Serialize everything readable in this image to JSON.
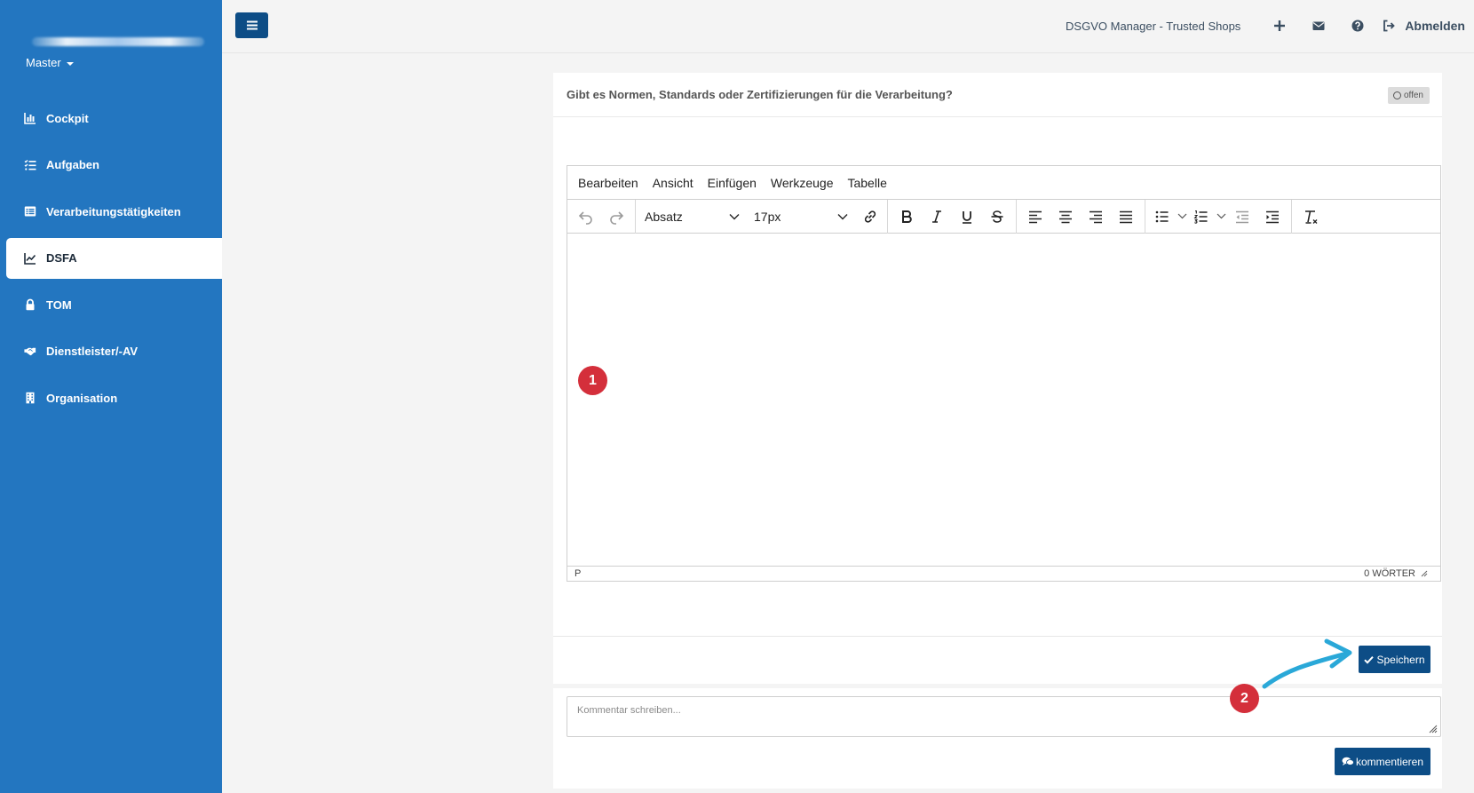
{
  "sidebar": {
    "org_selector": "Master",
    "items": [
      {
        "label": "Cockpit",
        "icon": "bar-chart-icon"
      },
      {
        "label": "Aufgaben",
        "icon": "task-list-icon"
      },
      {
        "label": "Verarbeitungstätigkeiten",
        "icon": "list-alt-icon"
      },
      {
        "label": "DSFA",
        "icon": "line-chart-icon",
        "active": true
      },
      {
        "label": "TOM",
        "icon": "lock-icon"
      },
      {
        "label": "Dienstleister/-AV",
        "icon": "handshake-icon"
      },
      {
        "label": "Organisation",
        "icon": "building-icon"
      }
    ]
  },
  "topbar": {
    "app_title": "DSGVO Manager - Trusted Shops",
    "logout_label": "Abmelden"
  },
  "question": {
    "title": "Gibt es Normen, Standards oder Zertifizierungen für die Verarbeitung?",
    "status": "offen"
  },
  "editor": {
    "menus": [
      "Bearbeiten",
      "Ansicht",
      "Einfügen",
      "Werkzeuge",
      "Tabelle"
    ],
    "block_format": "Absatz",
    "font_size": "17px",
    "path": "P",
    "word_count": "0 WÖRTER"
  },
  "actions": {
    "save_label": "Speichern",
    "comment_placeholder": "Kommentar schreiben...",
    "comment_button": "kommentieren"
  },
  "markers": [
    "1",
    "2"
  ],
  "colors": {
    "sidebar": "#2376c0",
    "primary_button": "#0d4d86",
    "marker": "#d42f3b",
    "arrow": "#2aa8d8"
  }
}
